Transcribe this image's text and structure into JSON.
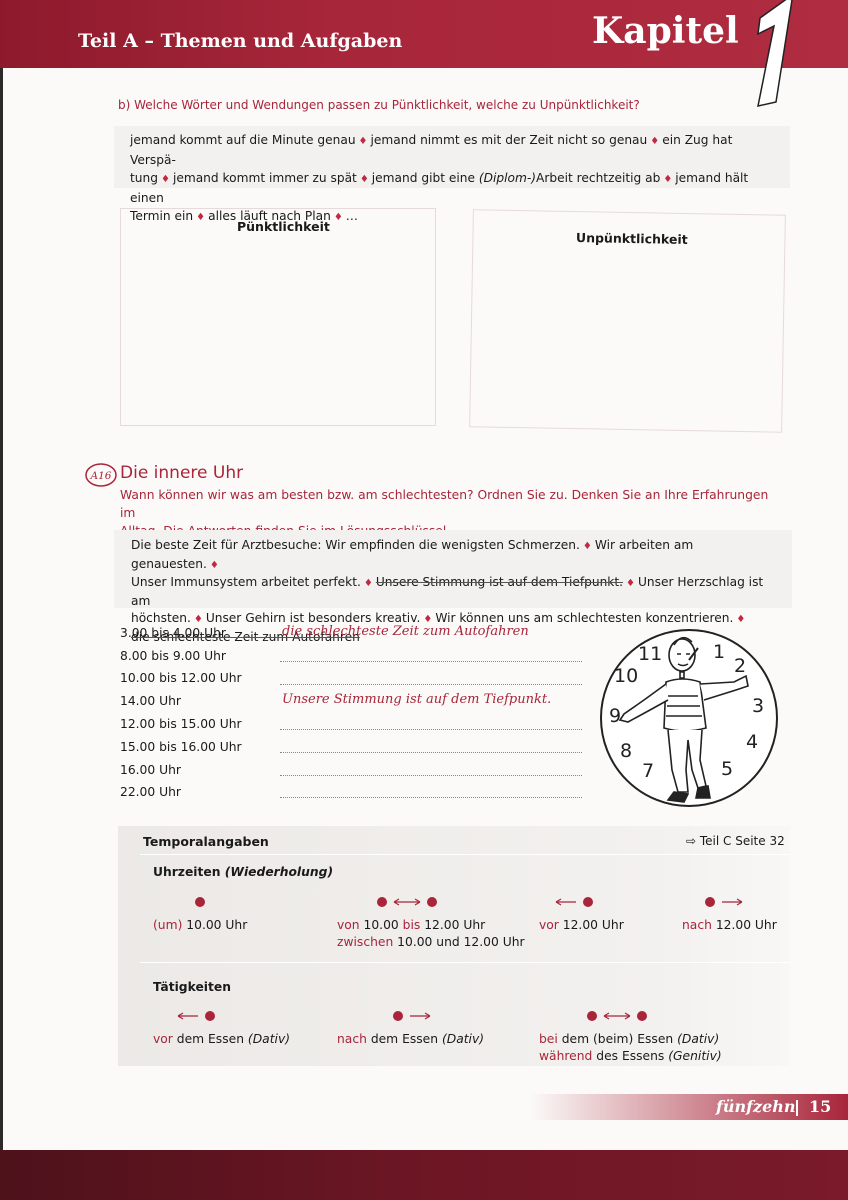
{
  "header": {
    "part": "Teil A – Themen und Aufgaben",
    "chapter": "Kapitel",
    "chapter_number": "1"
  },
  "exercise_b": {
    "question": "b) Welche Wörter und Wendungen passen zu Pünktlichkeit, welche zu Unpünktlichkeit?",
    "line1_a": "jemand kommt auf die Minute genau",
    "line1_b": "jemand nimmt es mit der Zeit nicht so genau",
    "line1_c": "ein Zug hat Verspä-",
    "line2_a": "tung",
    "line2_b": "jemand kommt immer zu spät",
    "line2_c": "jemand gibt eine",
    "line2_d": "(Diplom-)",
    "line2_e": "Arbeit rechtzeitig ab",
    "line2_f": "jemand hält einen",
    "line3_a": "Termin ein",
    "line3_b": "alles läuft nach Plan",
    "line3_c": "…",
    "bullet": "♦",
    "box_left_label": "Pünktlichkeit",
    "box_right_label": "Unpünktlichkeit"
  },
  "a16": {
    "badge": "A16",
    "title": "Die innere Uhr",
    "instruction_line1": "Wann können wir was am besten bzw. am schlechtesten? Ordnen Sie zu. Denken Sie an Ihre Erfahrungen im",
    "instruction_line2": "Alltag. Die Antworten finden Sie im Lösungsschlüssel.",
    "fact1_a": "Die beste Zeit für Arztbesuche: Wir empfinden die wenigsten Schmerzen.",
    "fact1_b": "Wir arbeiten am genauesten.",
    "fact2_a": "Unser Immunsystem arbeitet perfekt.",
    "fact2_b": "Unsere Stimmung ist auf dem Tiefpunkt.",
    "fact2_c": "Unser Herzschlag ist am",
    "fact3_a": "höchsten.",
    "fact3_b": "Unser Gehirn ist besonders kreativ.",
    "fact3_c": "Wir können uns am schlechtesten konzentrieren.",
    "fact4": "die schlechteste Zeit zum Autofahren",
    "times": [
      "3.00 bis 4.00 Uhr",
      "8.00 bis 9.00 Uhr",
      "10.00 bis 12.00 Uhr",
      "14.00 Uhr",
      "12.00 bis 15.00 Uhr",
      "15.00 bis 16.00 Uhr",
      "16.00 Uhr",
      "22.00 Uhr"
    ],
    "answer_1": "die schlechteste Zeit zum Autofahren",
    "answer_4": "Unsere Stimmung ist auf dem Tiefpunkt.",
    "clock_numbers": [
      "1",
      "2",
      "3",
      "4",
      "5",
      "7",
      "8",
      "9",
      "10",
      "11"
    ]
  },
  "temporal": {
    "title": "Temporalangaben",
    "ref": "⇨ Teil C Seite 32",
    "clock_title": "Uhrzeiten",
    "clock_title_italic": "(Wiederholung)",
    "c1_prep": "(um)",
    "c1_rest": "10.00 Uhr",
    "c2_prep1": "von",
    "c2_mid": "10.00",
    "c2_prep2": "bis",
    "c2_end": "12.00 Uhr",
    "c2_prep3": "zwischen",
    "c2_end2": "10.00 und 12.00 Uhr",
    "c3_prep": "vor",
    "c3_rest": "12.00 Uhr",
    "c4_prep": "nach",
    "c4_rest": "12.00 Uhr",
    "act_title": "Tätigkeiten",
    "a1_prep": "vor",
    "a1_rest": "dem Essen",
    "a1_case": "(Dativ)",
    "a2_prep": "nach",
    "a2_rest": "dem Essen",
    "a2_case": "(Dativ)",
    "a3_prep": "bei",
    "a3_rest": "dem (beim) Essen",
    "a3_case": "(Dativ)",
    "a3_prep2": "während",
    "a3_rest2": "des Essens",
    "a3_case2": "(Genitiv)"
  },
  "footer": {
    "page_word": "fünfzehn",
    "page_number": "15"
  },
  "colors": {
    "accent": "#a8253a",
    "header": "#8d1a2c",
    "footer": "#4d121b"
  }
}
